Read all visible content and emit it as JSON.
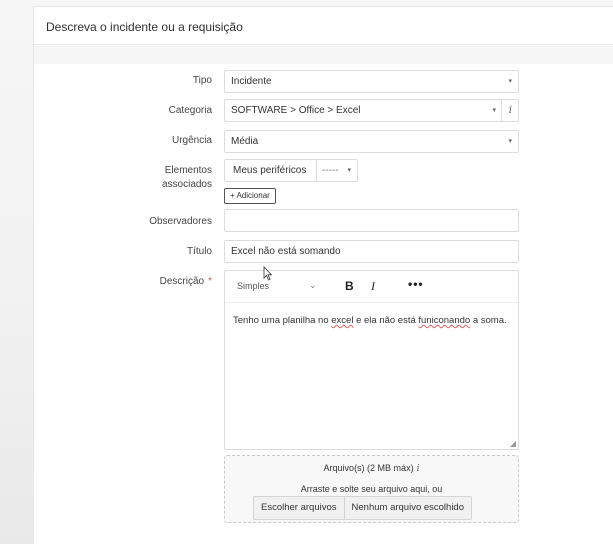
{
  "form": {
    "title": "Descreva o incidente ou a requisição",
    "tipo": {
      "label": "Tipo",
      "value": "Incidente"
    },
    "categoria": {
      "label": "Categoria",
      "value": "SOFTWARE > Office > Excel"
    },
    "urgencia": {
      "label": "Urgência",
      "value": "Média"
    },
    "elementos": {
      "label_line1": "Elementos",
      "label_line2": "associados",
      "select_value": "Meus periféricos",
      "select2_value": "-----",
      "add_button": "Adicionar"
    },
    "observadores": {
      "label": "Observadores",
      "value": ""
    },
    "titulo": {
      "label": "Título",
      "value": "Excel não está somando"
    },
    "descricao": {
      "label": "Descrição",
      "required_mark": "*",
      "toolbar_style": "Simples",
      "bold": "B",
      "italic": "I",
      "more": "•••",
      "text_part1": "Tenho uma planilha no ",
      "text_word_excel": "excel",
      "text_part2": " e ela não está ",
      "text_word_typo": "funiconando",
      "text_part3": " a soma."
    },
    "upload": {
      "title": "Arquivo(s) (2 MB máx)",
      "info_icon": "i",
      "subtitle": "Arraste e solte seu arquivo aqui, ou",
      "choose_button": "Escolher arquivos",
      "status": "Nenhum arquivo escolhido"
    }
  },
  "icons": {
    "caret": "▾",
    "info": "i",
    "plus": "+",
    "chevron": "⌄",
    "resize": "◢"
  }
}
